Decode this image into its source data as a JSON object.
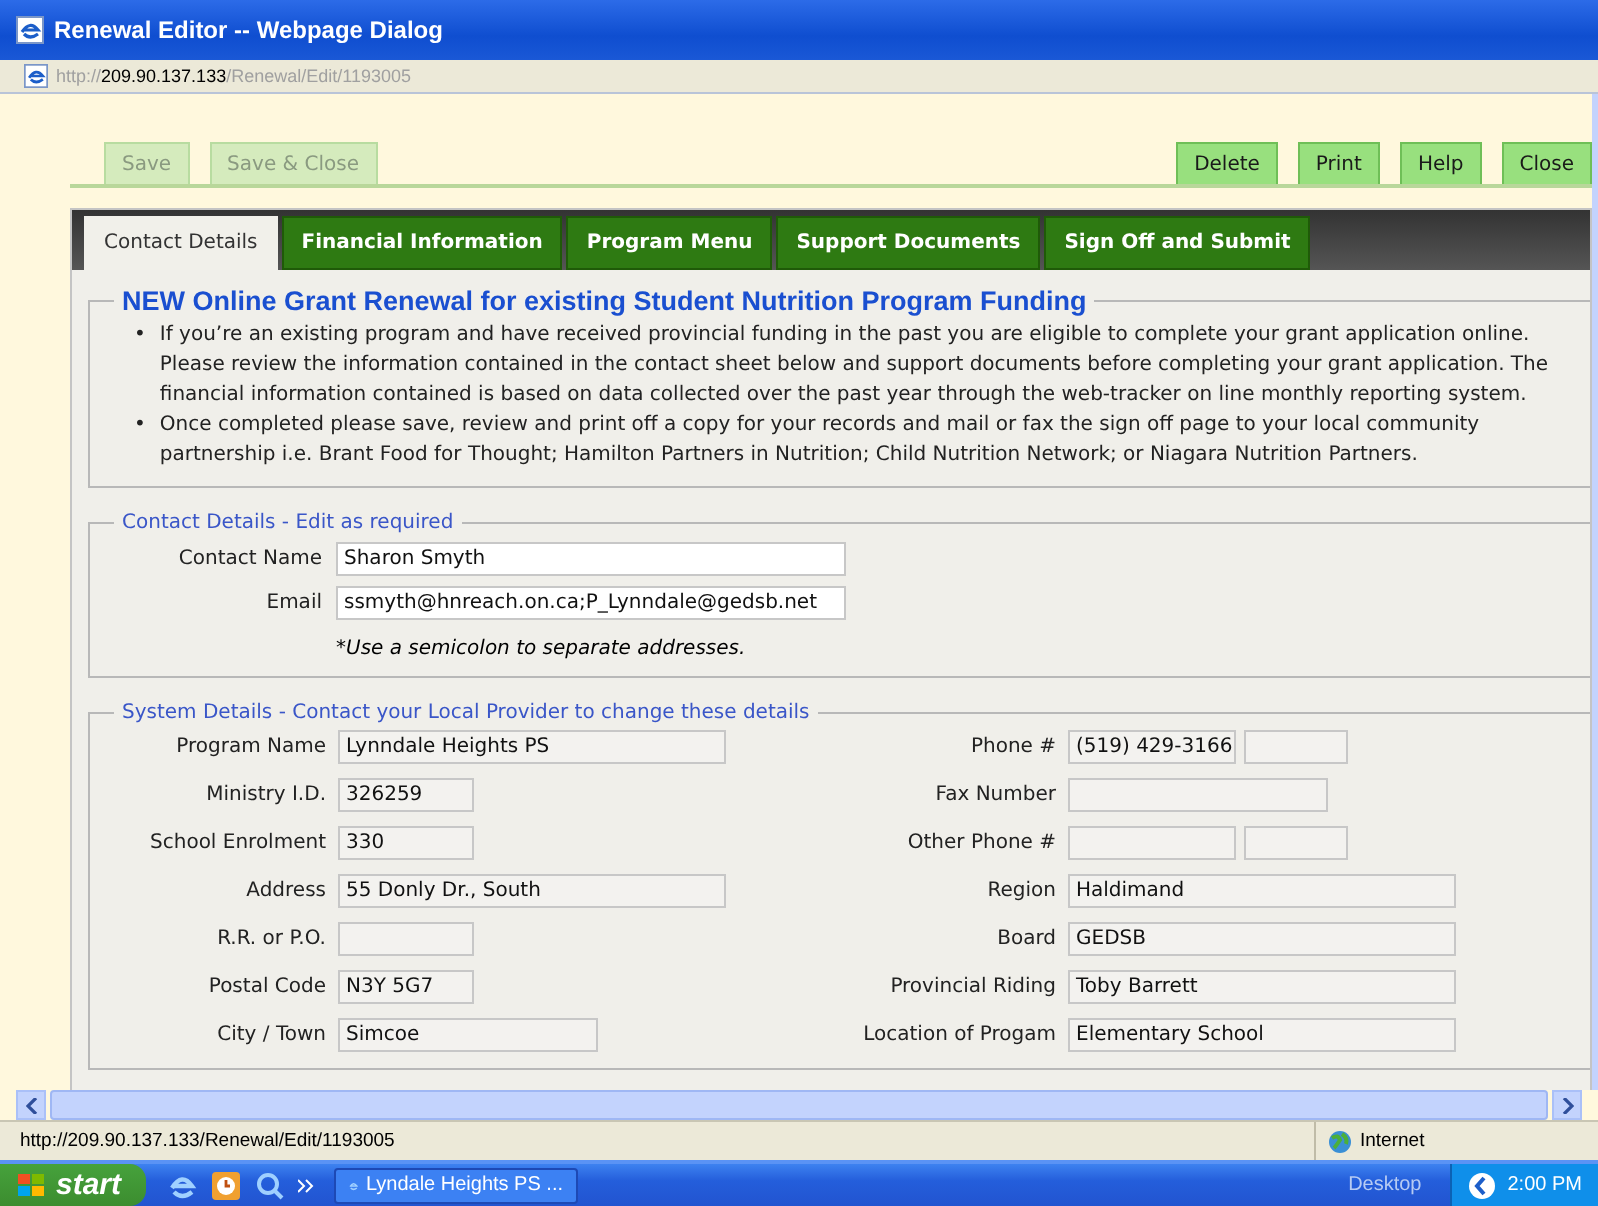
{
  "window": {
    "title": "Renewal Editor -- Webpage Dialog"
  },
  "address_bar": {
    "scheme": "http://",
    "host": "209.90.137.133",
    "path": "/Renewal/Edit/1193005"
  },
  "toolbar": {
    "left_buttons": [
      {
        "label": "Save",
        "disabled": true
      },
      {
        "label": "Save & Close",
        "disabled": true
      }
    ],
    "right_buttons": [
      {
        "label": "Delete",
        "disabled": false
      },
      {
        "label": "Print",
        "disabled": false
      },
      {
        "label": "Help",
        "disabled": false
      },
      {
        "label": "Close",
        "disabled": false
      }
    ]
  },
  "tabs": [
    {
      "label": "Contact Details",
      "selected": true
    },
    {
      "label": "Financial Information",
      "selected": false
    },
    {
      "label": "Program Menu",
      "selected": false
    },
    {
      "label": "Support Documents",
      "selected": false
    },
    {
      "label": "Sign Off and Submit",
      "selected": false
    }
  ],
  "intro": {
    "heading": "NEW Online Grant Renewal for existing Student Nutrition Program Funding",
    "bullet_marker": "•",
    "bullets": [
      "If you’re an existing program and have received provincial funding in the past you are eligible to complete your grant application online. Please review the information contained in the contact sheet below and support documents before completing your grant application. The financial information contained is based on data collected over the past year through the web-tracker on line monthly reporting system.",
      "Once completed please save, review and print off a copy for your records and mail or fax the sign off page to your local community partnership i.e. Brant Food for Thought; Hamilton Partners in Nutrition; Child Nutrition Network; or Niagara Nutrition Partners."
    ]
  },
  "contact": {
    "legend": "Contact Details - Edit as required",
    "fields": [
      {
        "label": "Contact Name",
        "value": "Sharon Smyth"
      },
      {
        "label": "Email",
        "value": "ssmyth@hnreach.on.ca;P_Lynndale@gedsb.net"
      }
    ],
    "note": "*Use a semicolon to separate addresses."
  },
  "system": {
    "legend": "System Details - Contact your Local Provider to change these details",
    "left_fields": [
      {
        "label": "Program Name",
        "value": "Lynndale Heights PS",
        "kind": "wide"
      },
      {
        "label": "Ministry I.D.",
        "value": "326259",
        "kind": "narrow"
      },
      {
        "label": "School Enrolment",
        "value": "330",
        "kind": "narrow"
      },
      {
        "label": "Address",
        "value": "55 Donly Dr., South",
        "kind": "wide"
      },
      {
        "label": "R.R. or P.O.",
        "kind": "narrow"
      },
      {
        "label": "Postal Code",
        "value": "N3Y 5G7",
        "kind": "narrow"
      },
      {
        "label": "City / Town",
        "value": "Simcoe",
        "kind": "medium"
      }
    ],
    "right_fields": [
      {
        "label": "Phone #",
        "value": "(519) 429-3166",
        "kind": "phone"
      },
      {
        "label": "Fax Number",
        "kind": "medium"
      },
      {
        "label": "Other Phone #",
        "kind": "phone"
      },
      {
        "label": "Region",
        "value": "Haldimand",
        "kind": "wide"
      },
      {
        "label": "Board",
        "value": "GEDSB",
        "kind": "wide"
      },
      {
        "label": "Provincial Riding",
        "value": "Toby Barrett",
        "kind": "wide"
      },
      {
        "label": "Location of Progam",
        "value": "Elementary School",
        "kind": "wide"
      }
    ]
  },
  "status_bar": {
    "url": "http://209.90.137.133/Renewal/Edit/1193005",
    "zone": "Internet"
  },
  "taskbar": {
    "start": "start",
    "task": "Lyndale Heights PS ...",
    "desktop": "Desktop",
    "clock": "2:00 PM"
  }
}
